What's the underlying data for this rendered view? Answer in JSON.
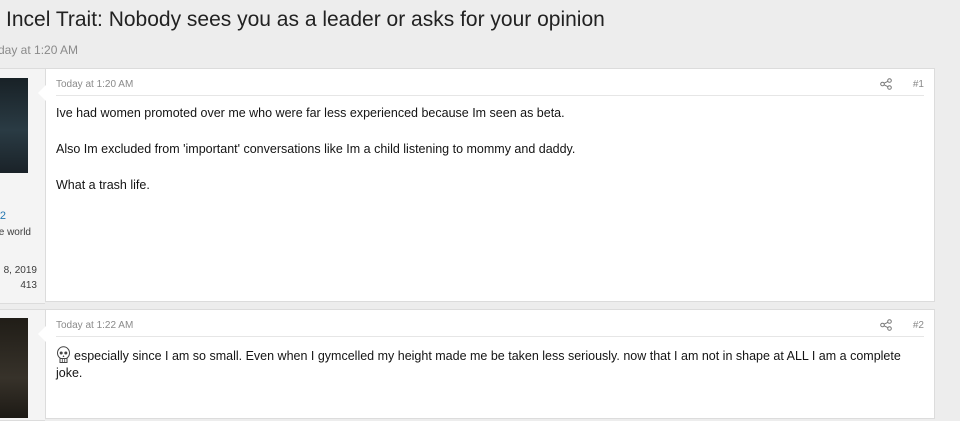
{
  "thread": {
    "title": "Incel Trait: Nobody sees you as a leader or asks for your opinion",
    "date": "day at 1:20 AM"
  },
  "user1": {
    "name_frag": "2",
    "title_frag": "e world",
    "joined_frag": "8, 2019",
    "posts_frag": "413"
  },
  "posts": [
    {
      "date": "Today at 1:20 AM",
      "number": "#1",
      "paragraphs": [
        "Ive had women promoted over me who were far less experienced because Im seen as beta.",
        "Also Im excluded from 'important' conversations like Im a child listening to mommy and daddy.",
        "What a trash life."
      ]
    },
    {
      "date": "Today at 1:22 AM",
      "number": "#2",
      "emoji": "skull-emoji-icon",
      "text": "especially since I am so small. Even when I gymcelled my height made me be taken less seriously. now that I am not in shape at ALL I am a complete joke."
    }
  ],
  "colors": {
    "background": "#ededed",
    "link": "#2577b1",
    "muted": "#8a8a8a"
  }
}
